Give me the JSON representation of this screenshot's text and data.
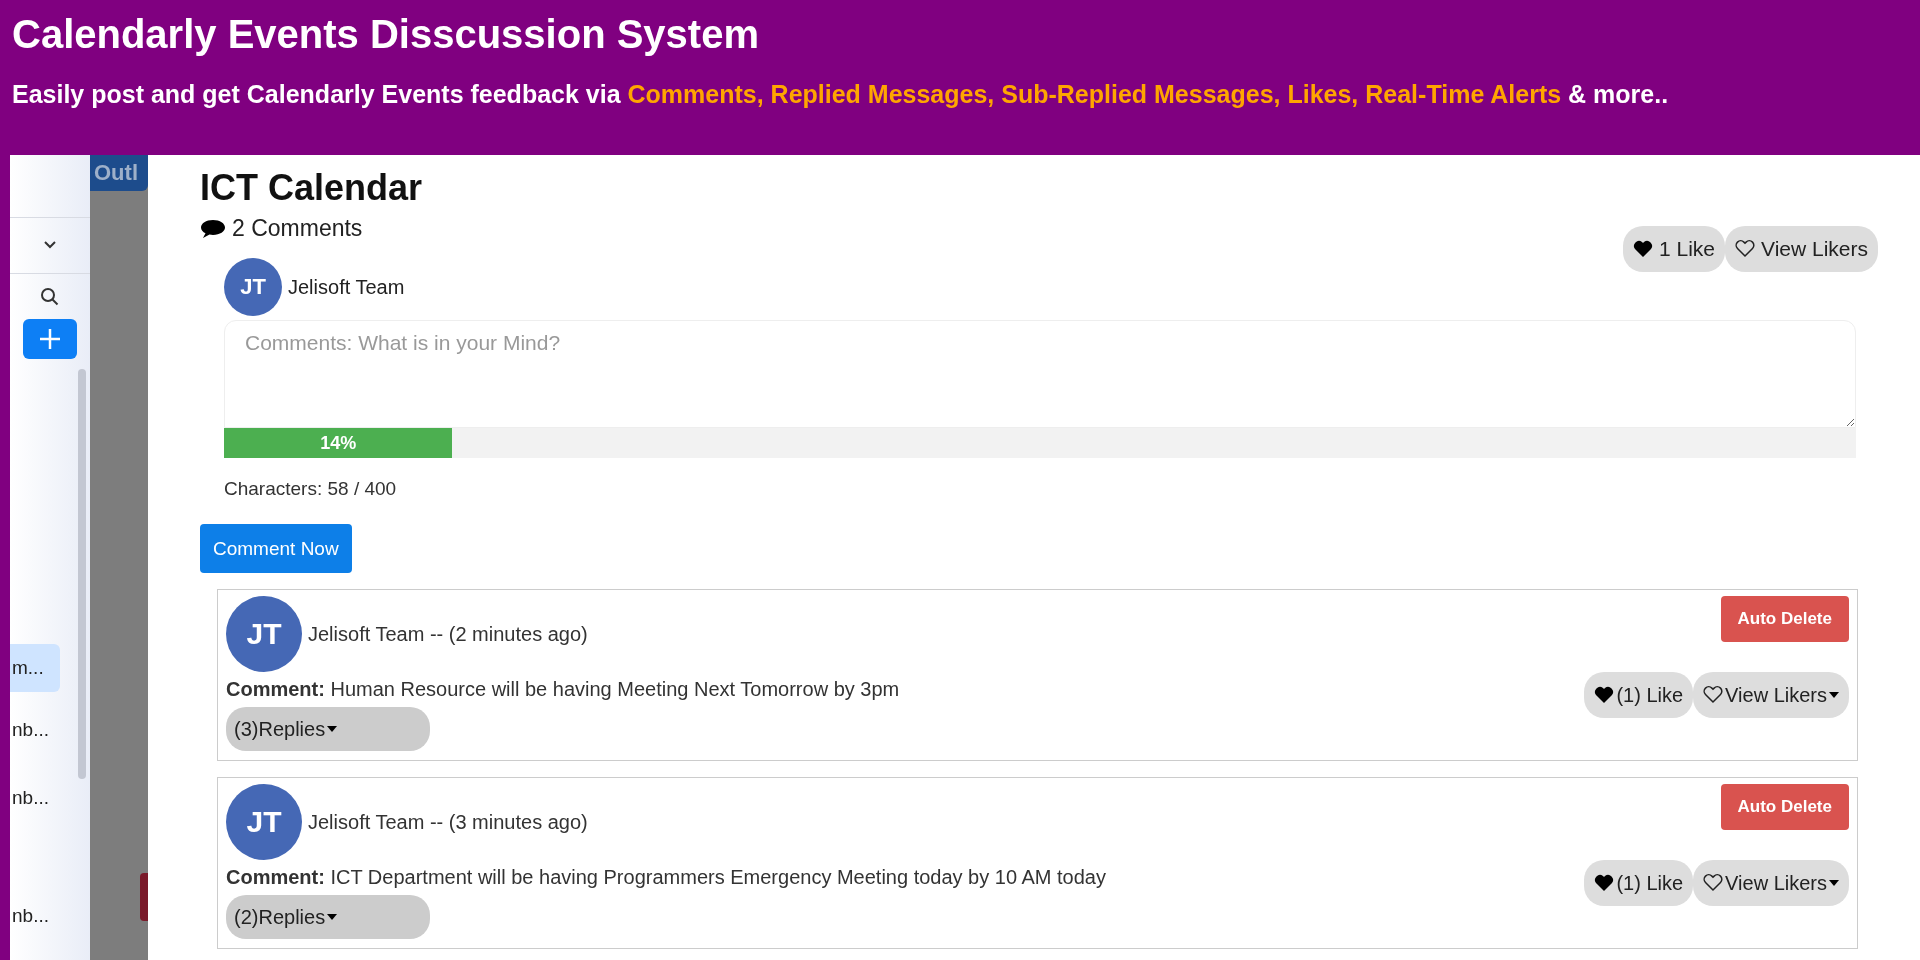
{
  "header": {
    "title": "Calendarly Events Disscussion System",
    "tagline_start": "Easily post and get Calendarly Events feedback via ",
    "tagline_highlight": "Comments, Replied Messages, Sub-Replied Messages, Likes, Real-Time Alerts",
    "tagline_end": " & more.."
  },
  "sidebar": {
    "items": [
      {
        "label": "m...",
        "selected": true
      },
      {
        "label": "nb...",
        "selected": false
      },
      {
        "label": "nb...",
        "selected": false
      },
      {
        "label": "nb...",
        "selected": false
      }
    ]
  },
  "background_tab": "Outl",
  "event": {
    "title": "ICT Calendar",
    "comment_count": "2 Comments",
    "like_button": "1 Like",
    "likers_button": "View Likers"
  },
  "composer": {
    "author_initials": "JT",
    "author": "Jelisoft Team",
    "placeholder": "Comments: What is in your Mind?",
    "progress": {
      "level": 0.14,
      "label": "14%"
    },
    "characters": "Characters: 58 / 400",
    "submit": "Comment Now"
  },
  "comments": [
    {
      "initials": "JT",
      "byline": "Jelisoft Team -- (2 minutes ago)",
      "text": "**Comment:** Human Resource will be having Meeting Next Tomorrow by 3pm",
      "replies": "(3)Replies",
      "delete": "Auto Delete",
      "like": "(1) Like",
      "likers": "View Likers"
    },
    {
      "initials": "JT",
      "byline": "Jelisoft Team -- (3 minutes ago)",
      "text": "**Comment:** ICT Department will be having Programmers Emergency Meeting today by 10 AM today",
      "replies": "(2)Replies",
      "delete": "Auto Delete",
      "like": "(1) Like",
      "likers": "View Likers"
    }
  ]
}
